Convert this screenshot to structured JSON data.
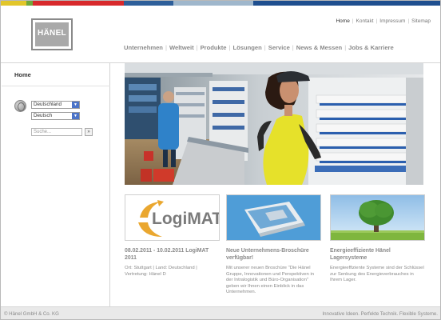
{
  "colors": {
    "stripe": [
      "#e2c62a",
      "#6fa83a",
      "#d8292c",
      "#2e5f9a",
      "#9fb7cc",
      "#1f4f8f"
    ],
    "select_arrow": "#4c74c8"
  },
  "logo": {
    "text": "HÄNEL"
  },
  "meta_nav": [
    {
      "label": "Home",
      "active": true
    },
    {
      "label": "Kontakt"
    },
    {
      "label": "Impressum"
    },
    {
      "label": "Sitemap"
    }
  ],
  "main_nav": [
    "Unternehmen",
    "Weltweit",
    "Produkte",
    "Lösungen",
    "Service",
    "News & Messen",
    "Jobs & Karriere"
  ],
  "sidebar": {
    "home": "Home",
    "country_select": {
      "value": "Deutschland",
      "icon": "chevron-down-icon"
    },
    "language_select": {
      "value": "Deutsch",
      "icon": "chevron-down-icon"
    },
    "search": {
      "placeholder": "Suche...",
      "button": "»"
    },
    "globe_icon": "globe-icon"
  },
  "teasers": [
    {
      "image_text": "LogiMAT",
      "title": "08.02.2011 - 10.02.2011 LogiMAT 2011",
      "body": "Ort: Stuttgart | Land: Deutschland | Vertretung: Hänel D"
    },
    {
      "title": "Neue Unternehmens-Broschüre verfügbar!",
      "body": "Mit unserer neuen Broschüre \"Die Hänel Gruppe, Innovationen und Perspektiven in der Intralogistik und Büro-Organisation\" geben wir Ihnen einen Einblick in das Unternehmen."
    },
    {
      "title": "Energieeffiziente Hänel Lagersysteme",
      "body": "Energieeffiziente Systeme sind der Schlüssel zur Senkung des Energieverbrauches in Ihrem Lager."
    }
  ],
  "footer": {
    "left": "© Hänel GmbH & Co. KG",
    "right": "Innovative Ideen. Perfekte Technik. Flexible Systeme."
  }
}
